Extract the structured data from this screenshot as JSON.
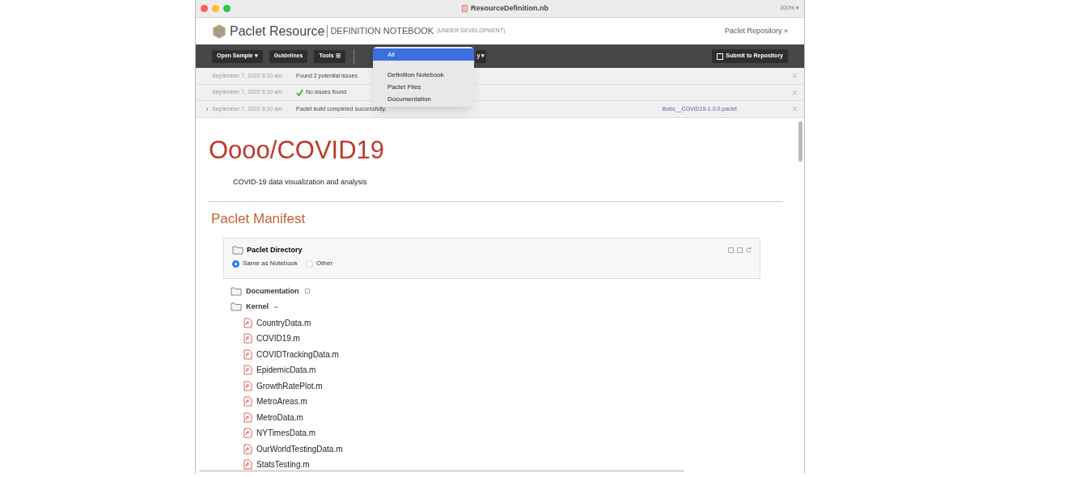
{
  "window": {
    "title": "ResourceDefinition.nb",
    "zoom": "100% ▾"
  },
  "header": {
    "logo_text": "Paclet Resource",
    "subtitle": "DEFINITION NOTEBOOK",
    "note": "(UNDER DEVELOPMENT)",
    "link": "Paclet Repository »"
  },
  "toolbar": {
    "buttons": [
      "Open Sample ▾",
      "Guidelines",
      "Tools ☰"
    ],
    "hidden_button": "y ▾",
    "submit": "Submit to Repository"
  },
  "dropdown": [
    {
      "label": "All",
      "selected": true
    },
    {
      "label": "Definition Notebook",
      "selected": false
    },
    {
      "label": "Paclet Files",
      "selected": false
    },
    {
      "label": "Documentation",
      "selected": false
    }
  ],
  "messages": [
    {
      "time": "September 7, 2022 9:10 am",
      "text": "Found 2 potential issues",
      "kind": "plain",
      "expandable": false
    },
    {
      "time": "September 7, 2022 9:10 am",
      "text": "No issues found",
      "kind": "ok",
      "expandable": false
    },
    {
      "time": "September 7, 2022 9:10 am",
      "text": "Paclet build completed successfully.",
      "kind": "plain",
      "expandable": true,
      "link": "Bobs__COVID19-1.0.0.paclet"
    }
  ],
  "title": "Oooo/COVID19",
  "description": "COVID-19 data visualization and analysis",
  "section": "Paclet Manifest",
  "directory": {
    "title": "Paclet Directory",
    "options": [
      {
        "label": "Same as Notebook",
        "selected": true
      },
      {
        "label": "Other",
        "selected": false
      }
    ]
  },
  "tree": [
    {
      "label": "Documentation",
      "expanded": false
    },
    {
      "label": "Kernel",
      "expanded": true,
      "children": [
        {
          "label": "CountryData.m"
        },
        {
          "label": "COVID19.m"
        },
        {
          "label": "COVIDTrackingData.m"
        },
        {
          "label": "EpidemicData.m"
        },
        {
          "label": "GrowthRatePlot.m"
        },
        {
          "label": "MetroAreas.m"
        },
        {
          "label": "MetroData.m"
        },
        {
          "label": "NYTimesData.m"
        },
        {
          "label": "OurWorldTestingData.m"
        },
        {
          "label": "StatsTesting.m"
        }
      ]
    }
  ]
}
